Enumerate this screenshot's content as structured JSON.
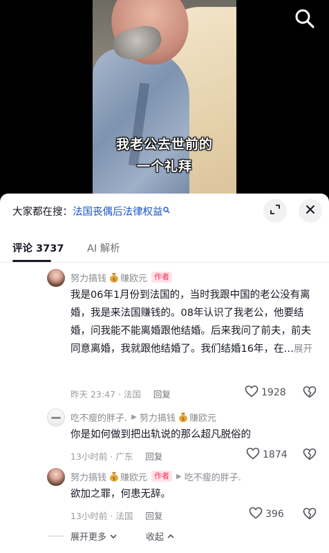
{
  "video": {
    "caption_line1": "我老公去世前的",
    "caption_line2": "一个礼拜"
  },
  "search_suggestion": {
    "prefix": "大家都在搜：",
    "query": "法国丧偶后法律权益"
  },
  "tabs": {
    "comments_label": "评论 3737",
    "ai_label": "AI 解析"
  },
  "comments": [
    {
      "user": "努力搞钱",
      "user_suffix": "赚欧元",
      "badge": "作者",
      "text": "我是06年1月份到法国的，当时我跟中国的老公没有离婚，我是来法国赚钱的。08年认识了我老公，他要结婚，问我能不能离婚跟他结婚。后来我问了前夫，前夫同意离婚，我就跟他结婚了。我们结婚16年，在…",
      "expand_label": "展开",
      "time_location": "昨天 23:47 · 法国",
      "reply_label": "回复",
      "likes": "1928"
    },
    {
      "user": "吃不瘦的胖子.",
      "reply_to": "努力搞钱",
      "reply_to_suffix": "赚欧元",
      "text": "你是如何做到把出轨说的那么超凡脱俗的",
      "time_location": "13小时前 · 广东",
      "reply_label": "回复",
      "likes": "1874"
    },
    {
      "user": "努力搞钱",
      "user_suffix": "赚欧元",
      "badge": "作者",
      "reply_to": "吃不瘦的胖子.",
      "text": "欲加之罪，何患无辞。",
      "time_location": "13小时前 · 法国",
      "reply_label": "回复",
      "likes": "396"
    }
  ],
  "footer": {
    "expand_more": "展开更多",
    "collapse": "收起"
  },
  "colors": {
    "accent": "#fe2c55",
    "link": "#1b56c6",
    "muted": "#8a8b91"
  },
  "icons": [
    "search-icon",
    "expand-icon",
    "close-icon",
    "money-bag-icon",
    "heart-icon",
    "dislike-icon",
    "chevron-down-icon",
    "chevron-up-icon"
  ]
}
